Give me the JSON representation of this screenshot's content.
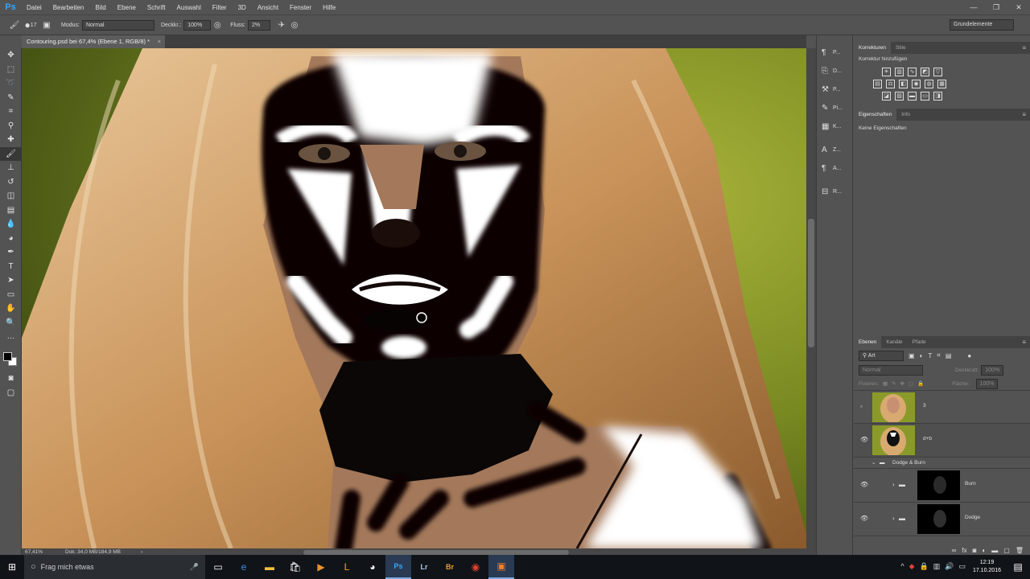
{
  "app": {
    "logo": "Ps",
    "menu": [
      "Datei",
      "Bearbeiten",
      "Bild",
      "Ebene",
      "Schrift",
      "Auswahl",
      "Filter",
      "3D",
      "Ansicht",
      "Fenster",
      "Hilfe"
    ]
  },
  "options": {
    "brush_size": "17",
    "mode_label": "Modus:",
    "mode_value": "Normal",
    "opacity_label": "Deckkr.:",
    "opacity_value": "100%",
    "flow_label": "Fluss:",
    "flow_value": "2%",
    "workspace": "Grundelemente"
  },
  "document": {
    "tab_title": "Contouring.psd bei 67,4% (Ebene 1, RGB/8) *",
    "zoom": "67,41%",
    "doc_size": "Dok: 34,0 MB/184,9 MB"
  },
  "icon_panel": [
    {
      "icon": "paragraph-style-icon",
      "label": "P..."
    },
    {
      "icon": "clone-source-icon",
      "label": "D..."
    },
    {
      "icon": "tool-presets-icon",
      "label": "P..."
    },
    {
      "icon": "brush-presets-icon",
      "label": "Pi..."
    },
    {
      "icon": "properties-icon",
      "label": "K..."
    },
    {
      "icon": "character-icon",
      "label": "Z..."
    },
    {
      "icon": "paragraph-icon",
      "label": "A..."
    },
    {
      "icon": "toolbox-icon",
      "label": "R..."
    }
  ],
  "corrections": {
    "tabs": [
      "Korrekturen",
      "Stile"
    ],
    "add_label": "Korrektur hinzufügen"
  },
  "properties": {
    "tabs": [
      "Eigenschaften",
      "Info"
    ],
    "empty": "Keine Eigenschaften"
  },
  "layers": {
    "tabs": [
      "Ebenen",
      "Kanäle",
      "Pfade"
    ],
    "filter": "Art",
    "blend": "Normal",
    "opacity_label": "Deckkraft:",
    "opacity_value": "100%",
    "lock_label": "Fixieren:",
    "fill_label": "Fläche:",
    "fill_value": "100%",
    "items": [
      {
        "name": "3",
        "visible": false
      },
      {
        "name": "d+b",
        "visible": true
      },
      {
        "name": "Dodge & Burn",
        "group": true
      },
      {
        "name": "Burn",
        "visible": true
      },
      {
        "name": "Dodge",
        "visible": true
      }
    ]
  },
  "taskbar": {
    "search": "Frag mich etwas",
    "time": "12:19",
    "date": "17.10.2016"
  },
  "colors": {
    "accent": "#31a8ff",
    "panel": "#535353",
    "foreground": "#000000",
    "background": "#ffffff"
  }
}
